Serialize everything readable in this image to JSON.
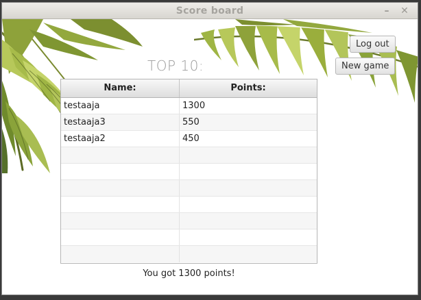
{
  "window": {
    "title": "Score board"
  },
  "header": {
    "heading": "TOP 10:"
  },
  "buttons": {
    "logout": "Log out",
    "new_game": "New game"
  },
  "table": {
    "columns": [
      "Name:",
      "Points:"
    ],
    "rows": [
      [
        "testaaja",
        "1300"
      ],
      [
        "testaaja3",
        "550"
      ],
      [
        "testaaja2",
        "450"
      ],
      [
        "",
        ""
      ],
      [
        "",
        ""
      ],
      [
        "",
        ""
      ],
      [
        "",
        ""
      ],
      [
        "",
        ""
      ],
      [
        "",
        ""
      ],
      [
        "",
        ""
      ]
    ]
  },
  "result": {
    "message": "You got 1300 points!"
  },
  "icons": {
    "minimize": "minimize-icon",
    "close": "close-icon",
    "decoration": "palm-leaves-image"
  }
}
